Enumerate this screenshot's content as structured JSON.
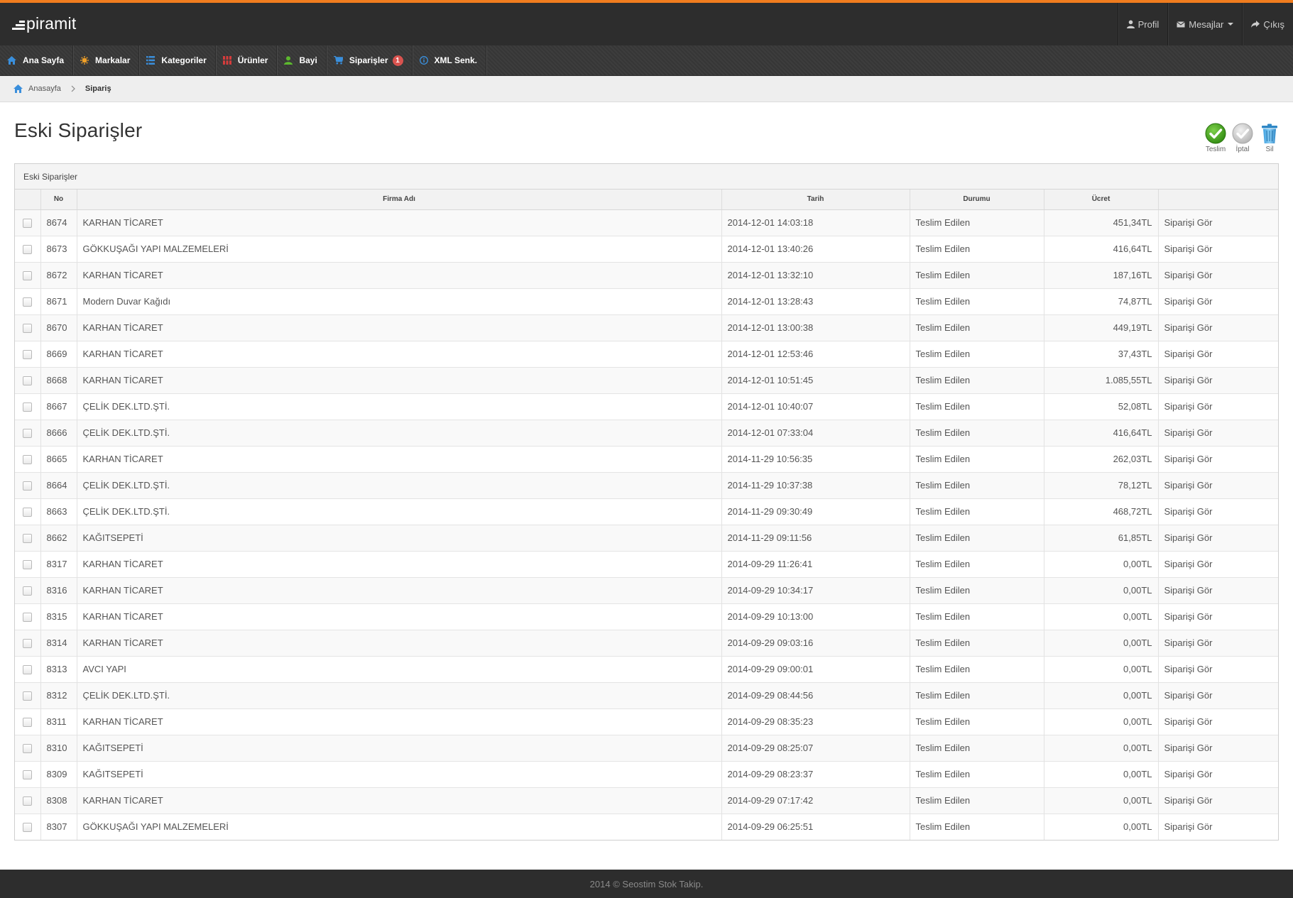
{
  "brand": {
    "name": "piramit"
  },
  "top_menu": {
    "profile": "Profil",
    "messages": "Mesajlar",
    "logout": "Çıkış"
  },
  "nav": [
    {
      "label": "Ana Sayfa",
      "icon": "home-icon",
      "color": "#3a8fdc"
    },
    {
      "label": "Markalar",
      "icon": "sun-icon",
      "color": "#f0a028"
    },
    {
      "label": "Kategoriler",
      "icon": "list-icon",
      "color": "#3a8fdc"
    },
    {
      "label": "Ürünler",
      "icon": "products-icon",
      "color": "#d43c3c"
    },
    {
      "label": "Bayi",
      "icon": "user-icon",
      "color": "#5cb82e"
    },
    {
      "label": "Siparişler",
      "icon": "cart-icon",
      "color": "#3a8fdc",
      "badge": "1"
    },
    {
      "label": "XML Senk.",
      "icon": "info-icon",
      "color": "#3a8fdc"
    }
  ],
  "breadcrumb": {
    "home": "Anasayfa",
    "current": "Sipariş"
  },
  "page": {
    "title": "Eski Siparişler",
    "panel_title": "Eski Siparişler"
  },
  "actions": {
    "deliver": "Teslim",
    "cancel": "İptal",
    "delete": "Sil"
  },
  "colors": {
    "accent": "#f07c1e",
    "dark": "#2d2d2d",
    "badge": "#d9534f"
  },
  "table": {
    "headers": {
      "no": "No",
      "firm": "Firma Adı",
      "date": "Tarih",
      "status": "Durumu",
      "price": "Ücret"
    },
    "rows": [
      {
        "no": "8674",
        "firm": "KARHAN TİCARET",
        "date": "2014-12-01 14:03:18",
        "status": "Teslim Edilen",
        "price": "451,34TL",
        "action": "Siparişi Gör"
      },
      {
        "no": "8673",
        "firm": "GÖKKUŞAĞI YAPI MALZEMELERİ",
        "date": "2014-12-01 13:40:26",
        "status": "Teslim Edilen",
        "price": "416,64TL",
        "action": "Siparişi Gör"
      },
      {
        "no": "8672",
        "firm": "KARHAN TİCARET",
        "date": "2014-12-01 13:32:10",
        "status": "Teslim Edilen",
        "price": "187,16TL",
        "action": "Siparişi Gör"
      },
      {
        "no": "8671",
        "firm": "Modern Duvar Kağıdı",
        "date": "2014-12-01 13:28:43",
        "status": "Teslim Edilen",
        "price": "74,87TL",
        "action": "Siparişi Gör"
      },
      {
        "no": "8670",
        "firm": "KARHAN TİCARET",
        "date": "2014-12-01 13:00:38",
        "status": "Teslim Edilen",
        "price": "449,19TL",
        "action": "Siparişi Gör"
      },
      {
        "no": "8669",
        "firm": "KARHAN TİCARET",
        "date": "2014-12-01 12:53:46",
        "status": "Teslim Edilen",
        "price": "37,43TL",
        "action": "Siparişi Gör"
      },
      {
        "no": "8668",
        "firm": "KARHAN TİCARET",
        "date": "2014-12-01 10:51:45",
        "status": "Teslim Edilen",
        "price": "1.085,55TL",
        "action": "Siparişi Gör"
      },
      {
        "no": "8667",
        "firm": "ÇELİK DEK.LTD.ŞTİ.",
        "date": "2014-12-01 10:40:07",
        "status": "Teslim Edilen",
        "price": "52,08TL",
        "action": "Siparişi Gör"
      },
      {
        "no": "8666",
        "firm": "ÇELİK DEK.LTD.ŞTİ.",
        "date": "2014-12-01 07:33:04",
        "status": "Teslim Edilen",
        "price": "416,64TL",
        "action": "Siparişi Gör"
      },
      {
        "no": "8665",
        "firm": "KARHAN TİCARET",
        "date": "2014-11-29 10:56:35",
        "status": "Teslim Edilen",
        "price": "262,03TL",
        "action": "Siparişi Gör"
      },
      {
        "no": "8664",
        "firm": "ÇELİK DEK.LTD.ŞTİ.",
        "date": "2014-11-29 10:37:38",
        "status": "Teslim Edilen",
        "price": "78,12TL",
        "action": "Siparişi Gör"
      },
      {
        "no": "8663",
        "firm": "ÇELİK DEK.LTD.ŞTİ.",
        "date": "2014-11-29 09:30:49",
        "status": "Teslim Edilen",
        "price": "468,72TL",
        "action": "Siparişi Gör"
      },
      {
        "no": "8662",
        "firm": "KAĞITSEPETİ",
        "date": "2014-11-29 09:11:56",
        "status": "Teslim Edilen",
        "price": "61,85TL",
        "action": "Siparişi Gör"
      },
      {
        "no": "8317",
        "firm": "KARHAN TİCARET",
        "date": "2014-09-29 11:26:41",
        "status": "Teslim Edilen",
        "price": "0,00TL",
        "action": "Siparişi Gör"
      },
      {
        "no": "8316",
        "firm": "KARHAN TİCARET",
        "date": "2014-09-29 10:34:17",
        "status": "Teslim Edilen",
        "price": "0,00TL",
        "action": "Siparişi Gör"
      },
      {
        "no": "8315",
        "firm": "KARHAN TİCARET",
        "date": "2014-09-29 10:13:00",
        "status": "Teslim Edilen",
        "price": "0,00TL",
        "action": "Siparişi Gör"
      },
      {
        "no": "8314",
        "firm": "KARHAN TİCARET",
        "date": "2014-09-29 09:03:16",
        "status": "Teslim Edilen",
        "price": "0,00TL",
        "action": "Siparişi Gör"
      },
      {
        "no": "8313",
        "firm": "AVCI YAPI",
        "date": "2014-09-29 09:00:01",
        "status": "Teslim Edilen",
        "price": "0,00TL",
        "action": "Siparişi Gör"
      },
      {
        "no": "8312",
        "firm": "ÇELİK DEK.LTD.ŞTİ.",
        "date": "2014-09-29 08:44:56",
        "status": "Teslim Edilen",
        "price": "0,00TL",
        "action": "Siparişi Gör"
      },
      {
        "no": "8311",
        "firm": "KARHAN TİCARET",
        "date": "2014-09-29 08:35:23",
        "status": "Teslim Edilen",
        "price": "0,00TL",
        "action": "Siparişi Gör"
      },
      {
        "no": "8310",
        "firm": "KAĞITSEPETİ",
        "date": "2014-09-29 08:25:07",
        "status": "Teslim Edilen",
        "price": "0,00TL",
        "action": "Siparişi Gör"
      },
      {
        "no": "8309",
        "firm": "KAĞITSEPETİ",
        "date": "2014-09-29 08:23:37",
        "status": "Teslim Edilen",
        "price": "0,00TL",
        "action": "Siparişi Gör"
      },
      {
        "no": "8308",
        "firm": "KARHAN TİCARET",
        "date": "2014-09-29 07:17:42",
        "status": "Teslim Edilen",
        "price": "0,00TL",
        "action": "Siparişi Gör"
      },
      {
        "no": "8307",
        "firm": "GÖKKUŞAĞI YAPI MALZEMELERİ",
        "date": "2014-09-29 06:25:51",
        "status": "Teslim Edilen",
        "price": "0,00TL",
        "action": "Siparişi Gör"
      }
    ]
  },
  "footer": {
    "text": "2014 © Seostim Stok Takip."
  }
}
